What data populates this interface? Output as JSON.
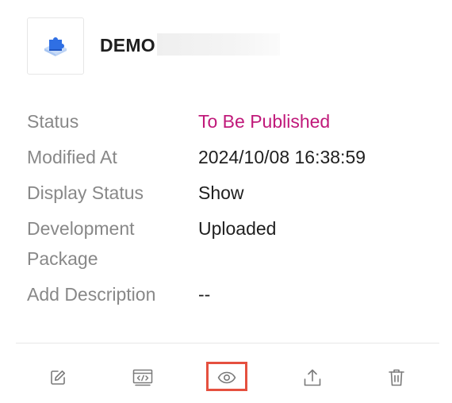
{
  "app": {
    "name": "DEMO",
    "icon": "puzzle-piece-icon"
  },
  "details": [
    {
      "label": "Status",
      "value": "To Be Published",
      "color": "#c0197a"
    },
    {
      "label": "Modified At",
      "value": "2024/10/08 16:38:59"
    },
    {
      "label": "Display Status",
      "value": "Show"
    },
    {
      "label": "Development Package",
      "value": "Uploaded"
    },
    {
      "label": "Add Description",
      "value": "--"
    }
  ],
  "actions": [
    {
      "name": "edit",
      "icon": "edit-icon"
    },
    {
      "name": "code",
      "icon": "code-icon"
    },
    {
      "name": "preview",
      "icon": "eye-icon",
      "highlighted": true
    },
    {
      "name": "publish",
      "icon": "upload-icon"
    },
    {
      "name": "delete",
      "icon": "trash-icon"
    }
  ],
  "colors": {
    "status_pending": "#c0197a",
    "highlight_border": "#e5503f",
    "icon_blue": "#2f6fe4"
  }
}
